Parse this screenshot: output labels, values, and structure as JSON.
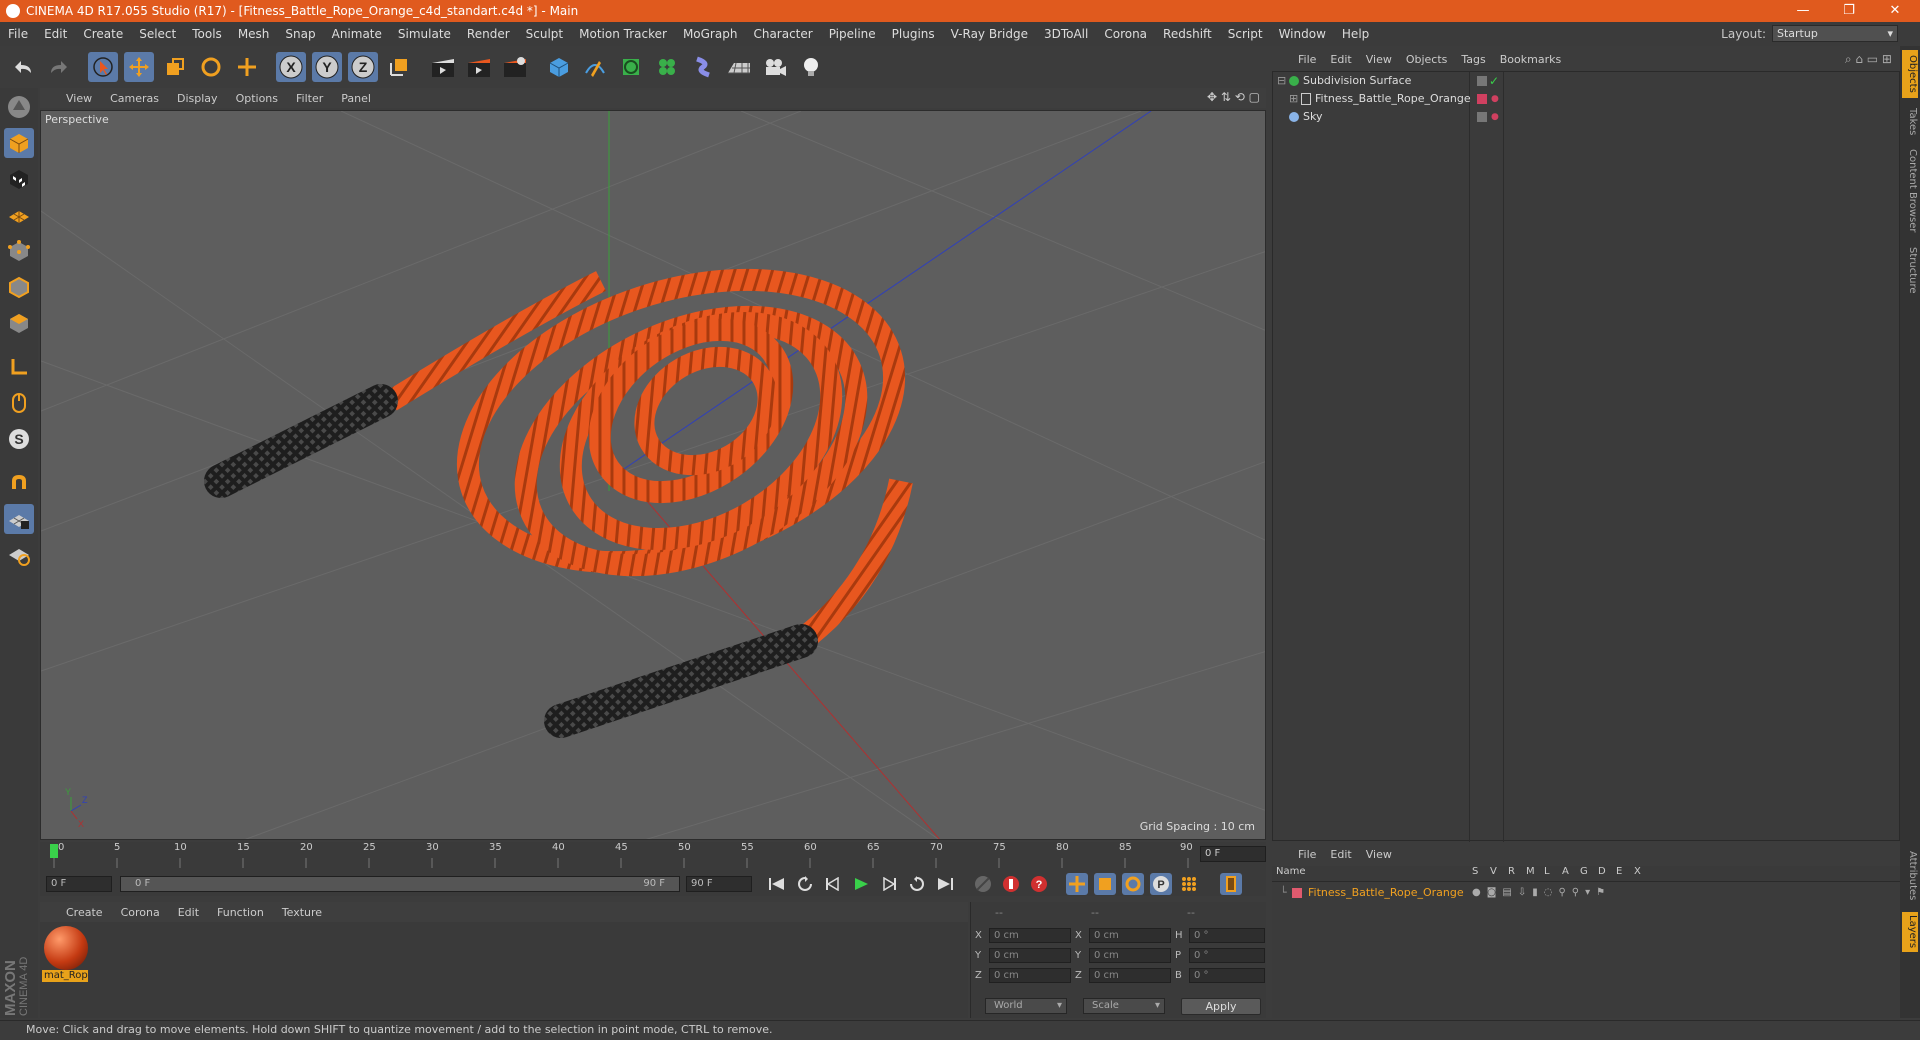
{
  "window": {
    "title": "CINEMA 4D R17.055 Studio (R17) - [Fitness_Battle_Rope_Orange_c4d_standart.c4d *] - Main",
    "controls": [
      "minimize-icon",
      "restore-icon",
      "close-icon"
    ]
  },
  "menubar": {
    "items": [
      "File",
      "Edit",
      "Create",
      "Select",
      "Tools",
      "Mesh",
      "Snap",
      "Animate",
      "Simulate",
      "Render",
      "Sculpt",
      "Motion Tracker",
      "MoGraph",
      "Character",
      "Pipeline",
      "Plugins",
      "V-Ray Bridge",
      "3DToAll",
      "Corona",
      "Redshift",
      "Script",
      "Window",
      "Help"
    ],
    "layout_label": "Layout:",
    "layout_value": "Startup"
  },
  "viewport": {
    "menu": [
      "View",
      "Cameras",
      "Display",
      "Options",
      "Filter",
      "Panel"
    ],
    "label": "Perspective",
    "grid_spacing": "Grid Spacing : 10 cm",
    "axis_labels": {
      "y": "Y",
      "z": "Z",
      "x": "X"
    }
  },
  "timeline": {
    "ticks": [
      "0",
      "5",
      "10",
      "15",
      "20",
      "25",
      "30",
      "35",
      "40",
      "45",
      "50",
      "55",
      "60",
      "65",
      "70",
      "75",
      "80",
      "85",
      "90"
    ],
    "current_frame": "0 F",
    "start_field": "0 F",
    "range_start": "0 F",
    "range_end": "90 F",
    "end_field": "90 F"
  },
  "material_manager": {
    "menu": [
      "Create",
      "Corona",
      "Edit",
      "Function",
      "Texture"
    ],
    "materials": [
      {
        "name": "mat_Rop"
      }
    ],
    "brand_top": "MAXON",
    "brand_bottom": "CINEMA 4D"
  },
  "coordinates": {
    "headers": [
      "--",
      "--",
      "--"
    ],
    "rows": [
      {
        "a": "X",
        "a_val": "0 cm",
        "b": "X",
        "b_val": "0 cm",
        "c": "H",
        "c_val": "0 °"
      },
      {
        "a": "Y",
        "a_val": "0 cm",
        "b": "Y",
        "b_val": "0 cm",
        "c": "P",
        "c_val": "0 °"
      },
      {
        "a": "Z",
        "a_val": "0 cm",
        "b": "Z",
        "b_val": "0 cm",
        "c": "B",
        "c_val": "0 °"
      }
    ],
    "mode_value": "World",
    "transform_value": "Scale",
    "apply_label": "Apply"
  },
  "object_manager": {
    "menu": [
      "File",
      "Edit",
      "View",
      "Objects",
      "Tags",
      "Bookmarks"
    ],
    "objects": [
      {
        "name": "Subdivision Surface"
      },
      {
        "name": "Fitness_Battle_Rope_Orange"
      },
      {
        "name": "Sky"
      }
    ]
  },
  "layer_manager": {
    "menu": [
      "File",
      "Edit",
      "View"
    ],
    "columns": [
      "Name",
      "S",
      "V",
      "R",
      "M",
      "L",
      "A",
      "G",
      "D",
      "E",
      "X"
    ],
    "layers": [
      {
        "name": "Fitness_Battle_Rope_Orange",
        "color": "#e05a6e"
      }
    ]
  },
  "right_tabs": {
    "top": [
      "Objects",
      "Takes",
      "Content Browser",
      "Structure"
    ],
    "bottom": [
      "Attributes",
      "Layers"
    ]
  },
  "status": "Move: Click and drag to move elements. Hold down SHIFT to quantize movement / add to the selection in point mode, CTRL to remove.",
  "colors": {
    "titlebar": "#e05a1e",
    "selection": "#5b7aa8",
    "rope": "#e8571f",
    "handle": "#2a2a2a",
    "material_label": "#e8a21a"
  }
}
